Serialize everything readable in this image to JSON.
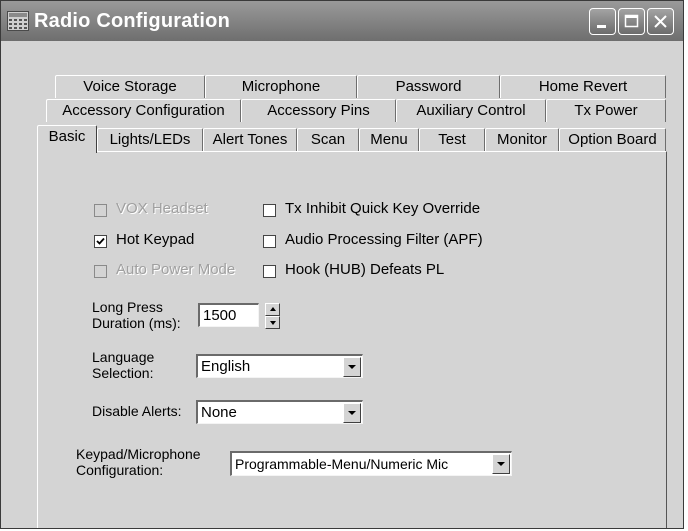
{
  "window": {
    "title": "Radio Configuration",
    "icon": "radio-grid-icon"
  },
  "title_buttons": {
    "minimize": "minimize-icon",
    "maximize": "maximize-icon",
    "close": "close-icon"
  },
  "tabs": {
    "row1": [
      "Voice Storage",
      "Microphone",
      "Password",
      "Home Revert"
    ],
    "row2": [
      "Accessory Configuration",
      "Accessory Pins",
      "Auxiliary Control",
      "Tx Power"
    ],
    "row3": [
      "Basic",
      "Lights/LEDs",
      "Alert Tones",
      "Scan",
      "Menu",
      "Test",
      "Monitor",
      "Option Board"
    ],
    "active": "Basic"
  },
  "checkboxes": {
    "vox_headset": {
      "label": "VOX  Headset",
      "checked": false,
      "enabled": false
    },
    "hot_keypad": {
      "label": "Hot Keypad",
      "checked": true,
      "enabled": true
    },
    "auto_power_mode": {
      "label": "Auto Power Mode",
      "checked": false,
      "enabled": false
    },
    "tx_inhibit": {
      "label": "Tx Inhibit Quick Key Override",
      "checked": false,
      "enabled": true
    },
    "apf": {
      "label": "Audio Processing Filter (APF)",
      "checked": false,
      "enabled": true
    },
    "hook_hub": {
      "label": "Hook (HUB) Defeats PL",
      "checked": false,
      "enabled": true
    }
  },
  "long_press": {
    "label_line1": "Long Press",
    "label_line2": "Duration (ms):",
    "value": "1500"
  },
  "language": {
    "label_line1": "Language",
    "label_line2": "Selection:",
    "value": "English"
  },
  "disable_alerts": {
    "label": "Disable Alerts:",
    "value": "None"
  },
  "keypad_mic": {
    "label_line1": "Keypad/Microphone",
    "label_line2": "Configuration:",
    "value": "Programmable-Menu/Numeric Mic"
  },
  "colors": {
    "titlebar": "#7f7f7f",
    "face": "#d4d4d4",
    "field": "#ffffff"
  }
}
